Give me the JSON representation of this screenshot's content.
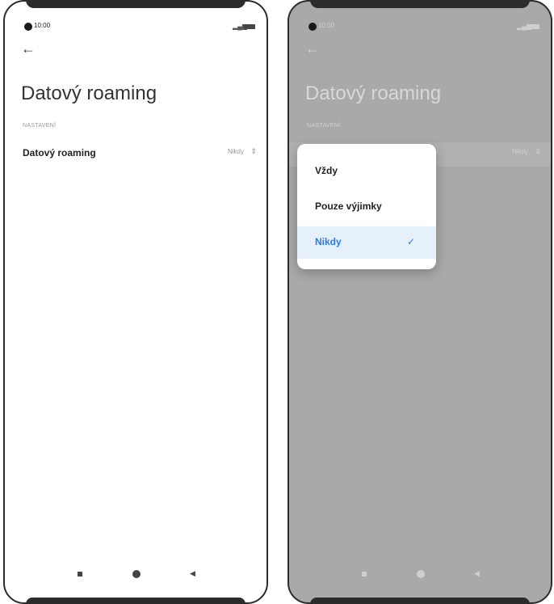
{
  "left": {
    "time": "10:00",
    "back_icon": "←",
    "title": "Datový roaming",
    "section": "NASTAVENÍ",
    "row_label": "Datový roaming",
    "row_value": "Nikdy"
  },
  "right": {
    "time": "10:00",
    "back_icon": "←",
    "title": "Datový roaming",
    "section": "NASTAVENÍ",
    "row_value": "Nikdy",
    "options": [
      "Vždy",
      "Pouze výjimky",
      "Nikdy"
    ],
    "selected": "Nikdy"
  },
  "colors": {
    "accent": "#2f7bdc",
    "overlay": "#a9a9a9"
  }
}
